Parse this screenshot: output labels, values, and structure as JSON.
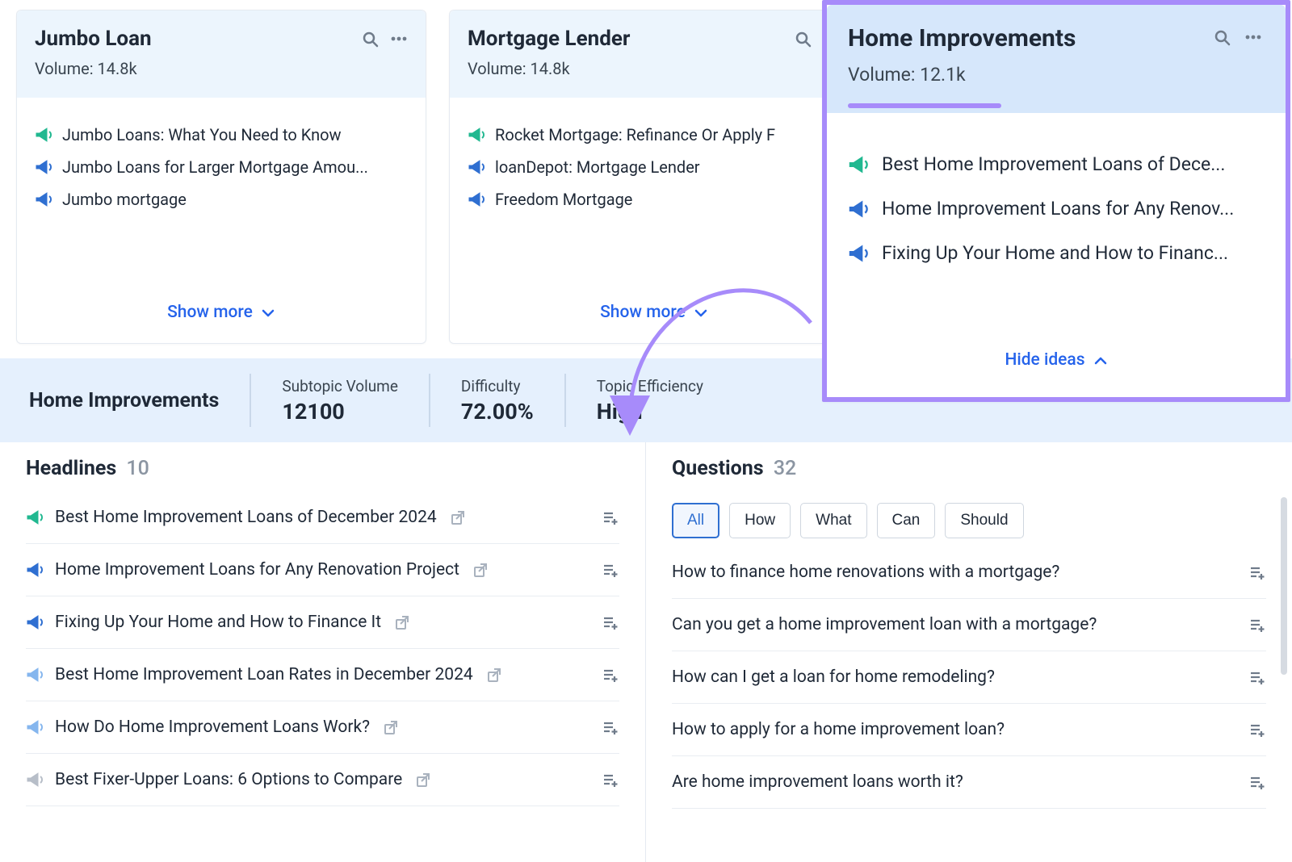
{
  "cards": [
    {
      "title": "Jumbo Loan",
      "volume": "Volume: 14.8k",
      "ideas": [
        {
          "color": "green",
          "text": "Jumbo Loans: What You Need to Know"
        },
        {
          "color": "blue",
          "text": "Jumbo Loans for Larger Mortgage Amou..."
        },
        {
          "color": "blue",
          "text": "Jumbo mortgage"
        }
      ],
      "footer": "Show more"
    },
    {
      "title": "Mortgage Lender",
      "volume": "Volume: 14.8k",
      "ideas": [
        {
          "color": "green",
          "text": "Rocket Mortgage: Refinance Or Apply F"
        },
        {
          "color": "blue",
          "text": "loanDepot: Mortgage Lender"
        },
        {
          "color": "blue",
          "text": "Freedom Mortgage"
        }
      ],
      "footer": "Show more"
    },
    {
      "title": "Home Improvements",
      "volume": "Volume: 12.1k",
      "ideas": [
        {
          "color": "green",
          "text": "Best Home Improvement Loans of Dece..."
        },
        {
          "color": "blue",
          "text": "Home Improvement Loans for Any Renov..."
        },
        {
          "color": "blue",
          "text": "Fixing Up Your Home and How to Financ..."
        }
      ],
      "footer": "Hide ideas"
    }
  ],
  "metrics": {
    "title": "Home Improvements",
    "subtopic_volume_label": "Subtopic Volume",
    "subtopic_volume_value": "12100",
    "difficulty_label": "Difficulty",
    "difficulty_value": "72.00%",
    "efficiency_label": "Topic Efficiency",
    "efficiency_value": "High"
  },
  "headlines": {
    "title": "Headlines",
    "count": "10",
    "items": [
      {
        "color": "green",
        "text": "Best Home Improvement Loans of December 2024"
      },
      {
        "color": "blue",
        "text": "Home Improvement Loans for Any Renovation Project"
      },
      {
        "color": "blue",
        "text": "Fixing Up Your Home and How to Finance It"
      },
      {
        "color": "ltblue",
        "text": "Best Home Improvement Loan Rates in December 2024"
      },
      {
        "color": "ltblue",
        "text": "How Do Home Improvement Loans Work?"
      },
      {
        "color": "gray",
        "text": "Best Fixer-Upper Loans: 6 Options to Compare"
      }
    ]
  },
  "questions": {
    "title": "Questions",
    "count": "32",
    "filters": [
      "All",
      "How",
      "What",
      "Can",
      "Should"
    ],
    "active_filter": 0,
    "items": [
      "How to finance home renovations with a mortgage?",
      "Can you get a home improvement loan with a mortgage?",
      "How can I get a loan for home remodeling?",
      "How to apply for a home improvement loan?",
      "Are home improvement loans worth it?"
    ]
  },
  "colors": {
    "green": "#21b890",
    "blue": "#2f6fd1",
    "ltblue": "#85b6ee",
    "gray": "#b7bec8"
  }
}
